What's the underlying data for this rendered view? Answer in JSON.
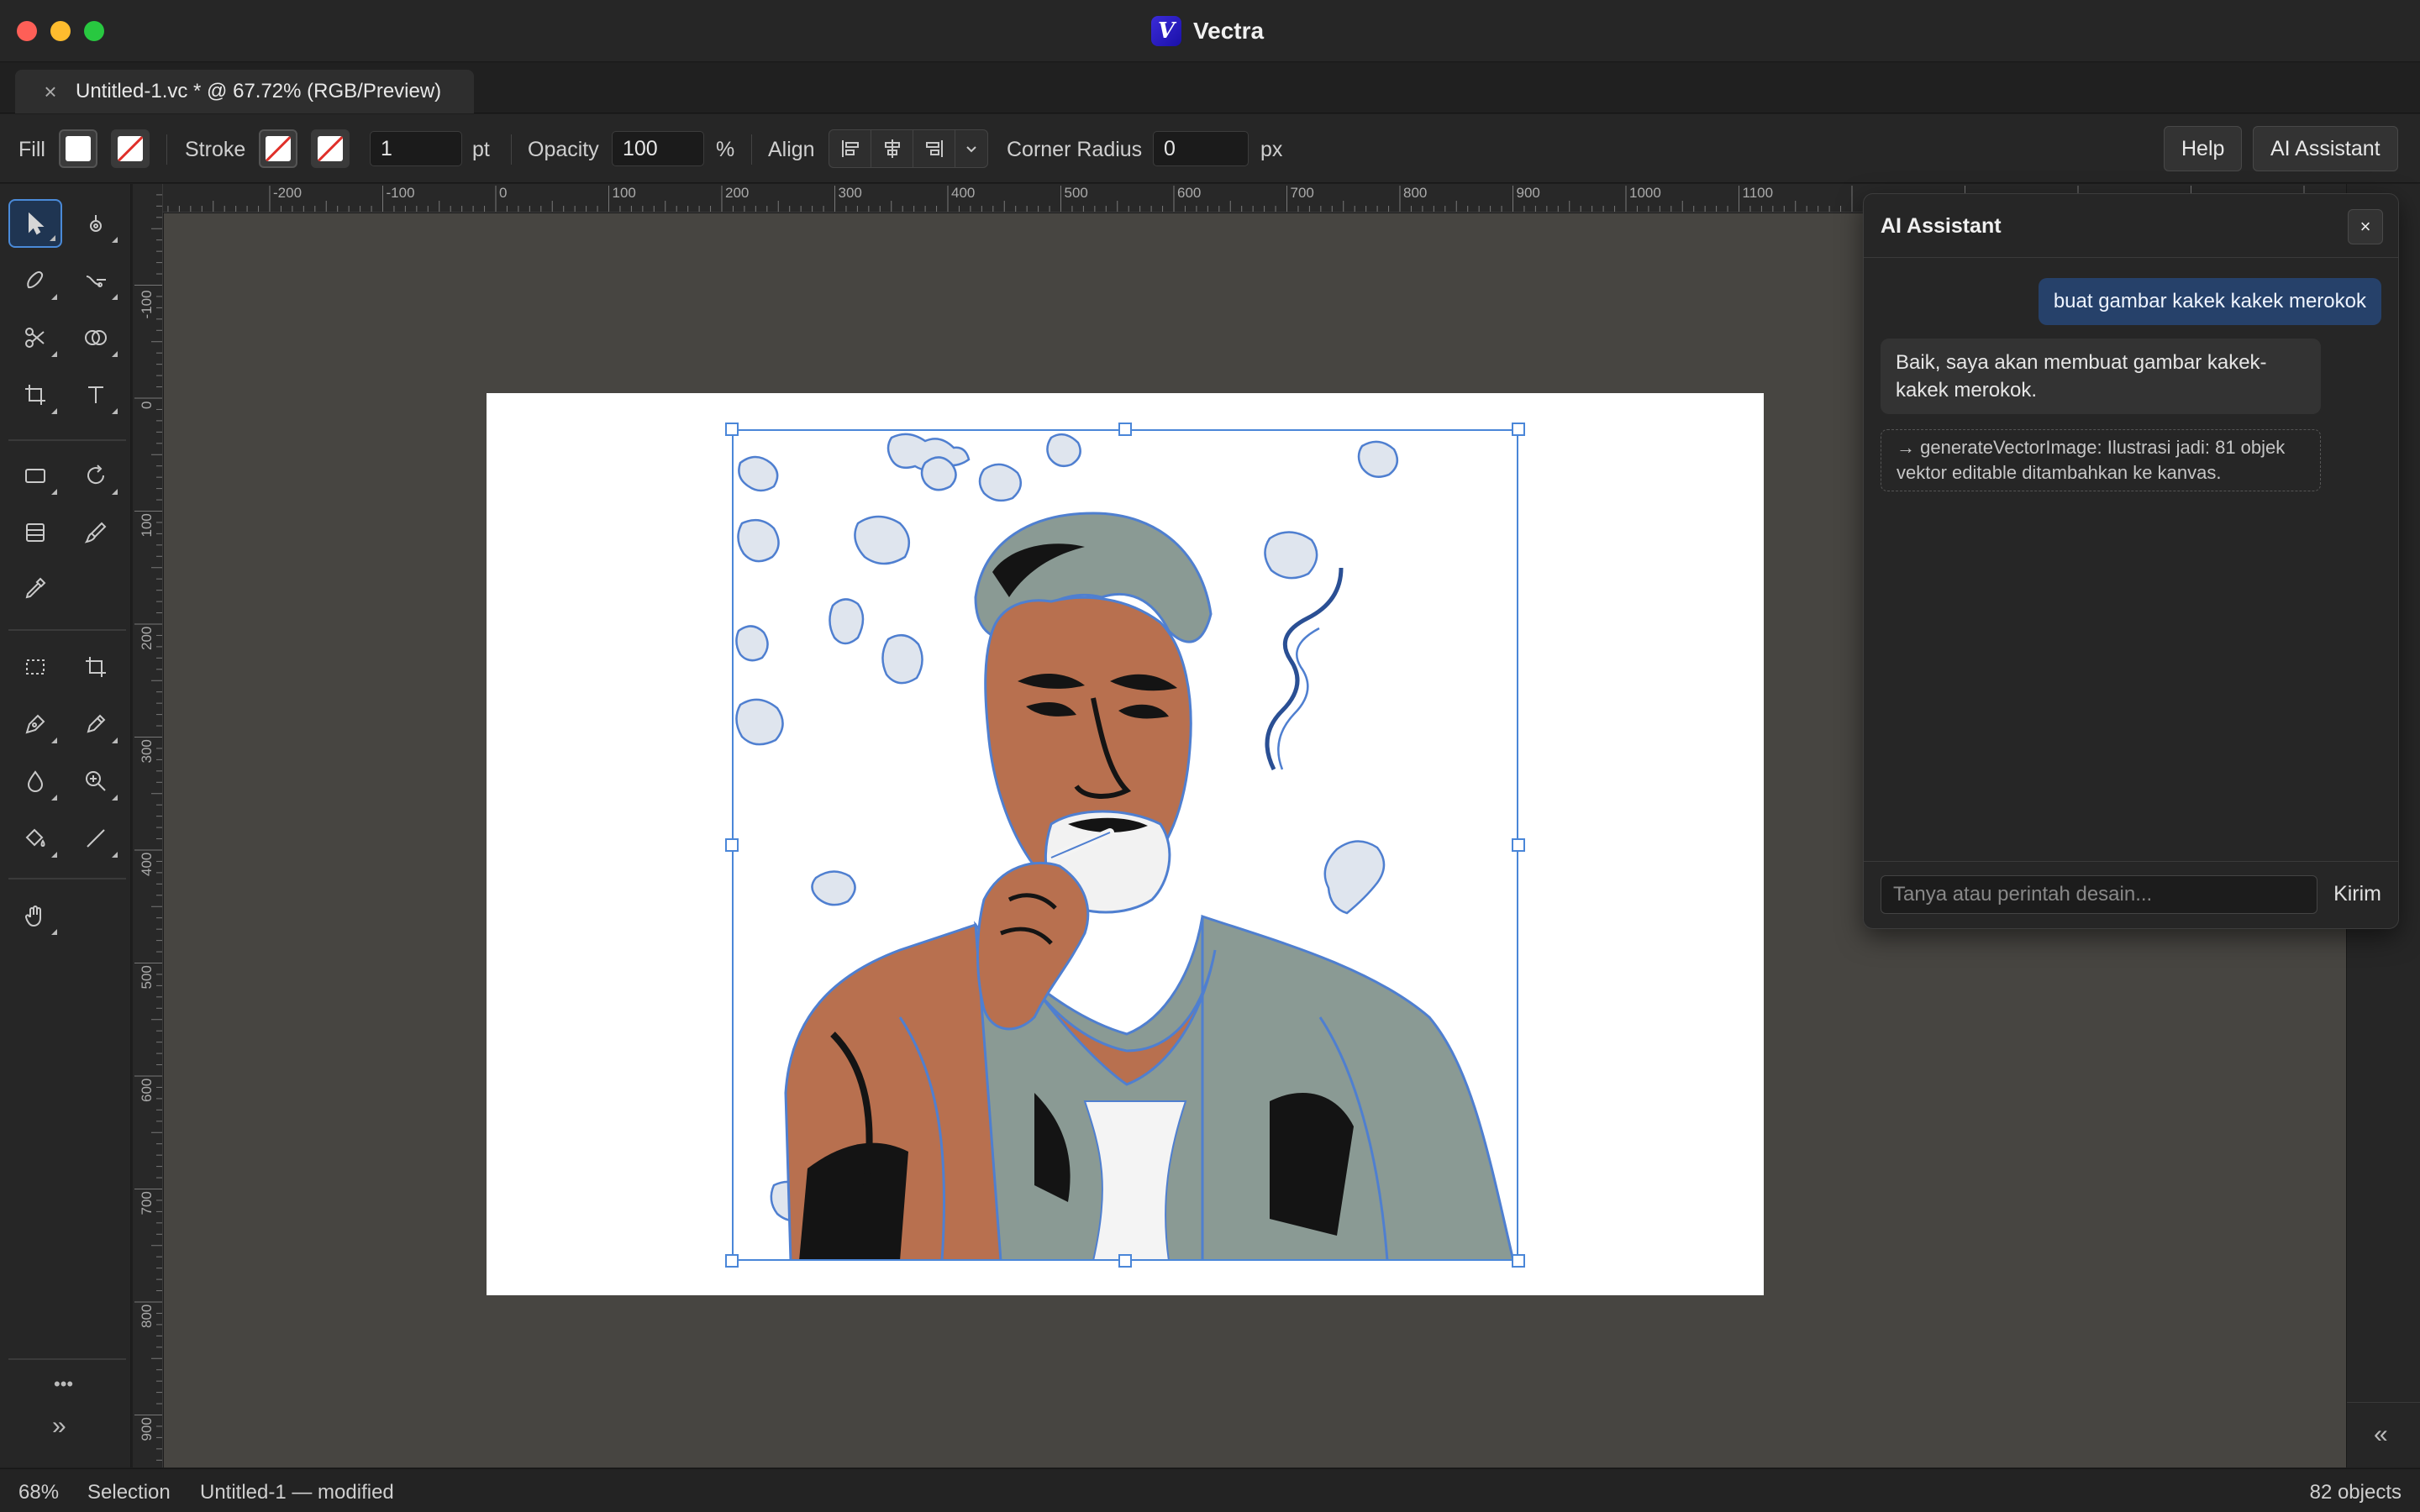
{
  "app": {
    "title": "Vectra",
    "logo_letter": "V"
  },
  "document_tab": {
    "label": "Untitled-1.vc * @ 67.72% (RGB/Preview)"
  },
  "controls": {
    "fill_label": "Fill",
    "stroke_label": "Stroke",
    "stroke_width": "1",
    "stroke_unit": "pt",
    "opacity_label": "Opacity",
    "opacity_value": "100",
    "opacity_unit": "%",
    "align_label": "Align",
    "corner_radius_label": "Corner Radius",
    "corner_radius_value": "0",
    "corner_radius_unit": "px",
    "help_label": "Help",
    "ai_assistant_label": "AI Assistant"
  },
  "tools": [
    "selection-tool",
    "direct-selection-tool",
    "blob-brush-tool",
    "curvature-tool",
    "scissors-tool",
    "shape-builder-tool",
    "artboard-tool",
    "type-tool",
    "rectangle-tool",
    "rotate-tool",
    "chart-tool",
    "brush-tool",
    "eyedropper-tool",
    "marquee-tool",
    "crop-tool",
    "pen-tool",
    "pencil-tool",
    "blur-tool",
    "zoom-tool",
    "paint-bucket-tool",
    "line-tool",
    "hand-tool"
  ],
  "toolbar_footer": {
    "more": "•••",
    "expand": "»"
  },
  "rulers": {
    "top": [
      "-200",
      "-100",
      "0",
      "100",
      "200",
      "300",
      "400",
      "500",
      "600",
      "700",
      "800",
      "900",
      "1000",
      "1100"
    ],
    "left": [
      "-100",
      "0",
      "100",
      "200",
      "300",
      "400",
      "500",
      "600",
      "700",
      "800",
      "900"
    ]
  },
  "ai_panel": {
    "title": "AI Assistant",
    "close": "×",
    "user_message": "buat gambar kakek kakek merokok",
    "assistant_message": "Baik, saya akan membuat gambar kakek-kakek merokok.",
    "tool_result": "→ generateVectorImage: Ilustrasi jadi: 81 objek vektor editable ditambahkan ke kanvas.",
    "input_placeholder": "Tanya atau perintah desain...",
    "send_label": "Kirim"
  },
  "right_strip": {
    "collapse": "«"
  },
  "status": {
    "zoom": "68%",
    "tool": "Selection",
    "document": "Untitled-1 — modified",
    "object_count": "82 objects"
  },
  "colors": {
    "selection": "#4a86d8",
    "terracotta": "#b8704f",
    "sage_gray": "#8a9a94",
    "ink": "#141414",
    "outline_blue": "#4f7fd0",
    "canvas_bg": "#474541"
  }
}
